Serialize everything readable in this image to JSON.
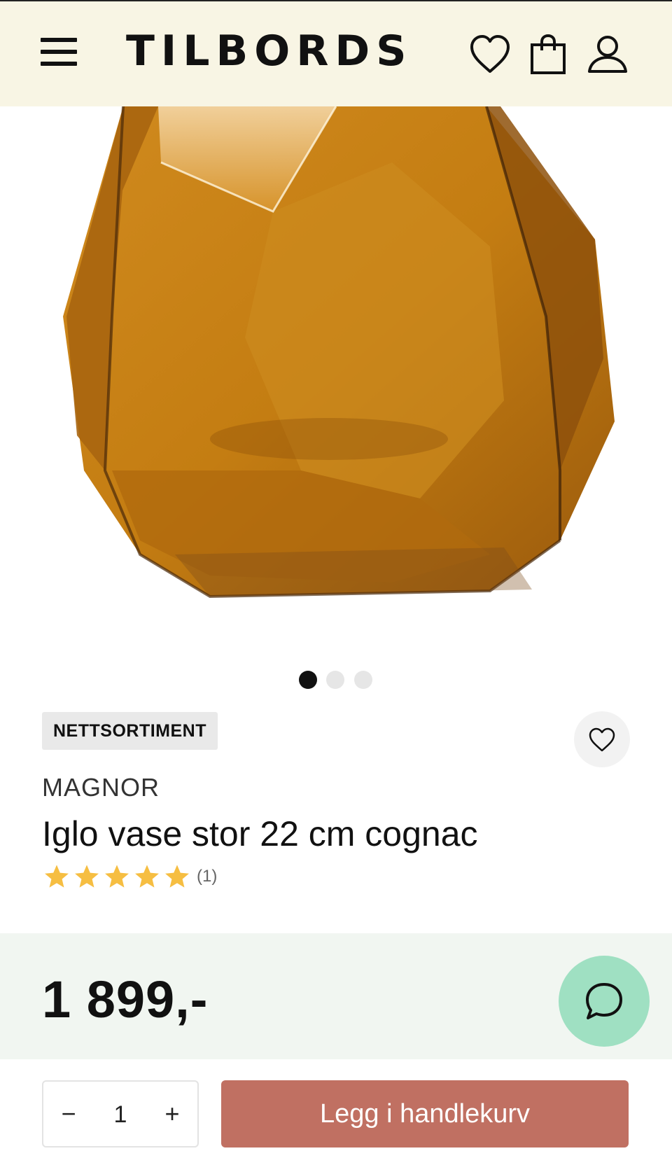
{
  "header": {
    "logo": "TILBORDS",
    "icons": [
      "menu-icon",
      "heart-icon",
      "shopping-bag-icon",
      "user-icon"
    ]
  },
  "product": {
    "image_alt": "vase-image",
    "gallery_dots": 3,
    "gallery_active_index": 0,
    "badge": "NETTSORTIMENT",
    "brand": "MAGNOR",
    "title": "Iglo vase stor 22 cm cognac",
    "rating": 5,
    "rating_max": 5,
    "review_count": "(1)",
    "price": "1 899,-"
  },
  "purchase": {
    "quantity": "1",
    "minus_label": "−",
    "plus_label": "+",
    "add_to_cart_label": "Legg i handlekurv"
  },
  "colors": {
    "header_bg": "#f8f5e4",
    "price_band_bg": "#f1f6f1",
    "chat_bg": "#9fe0c2",
    "cart_button": "#c07062",
    "star": "#f6be42"
  }
}
